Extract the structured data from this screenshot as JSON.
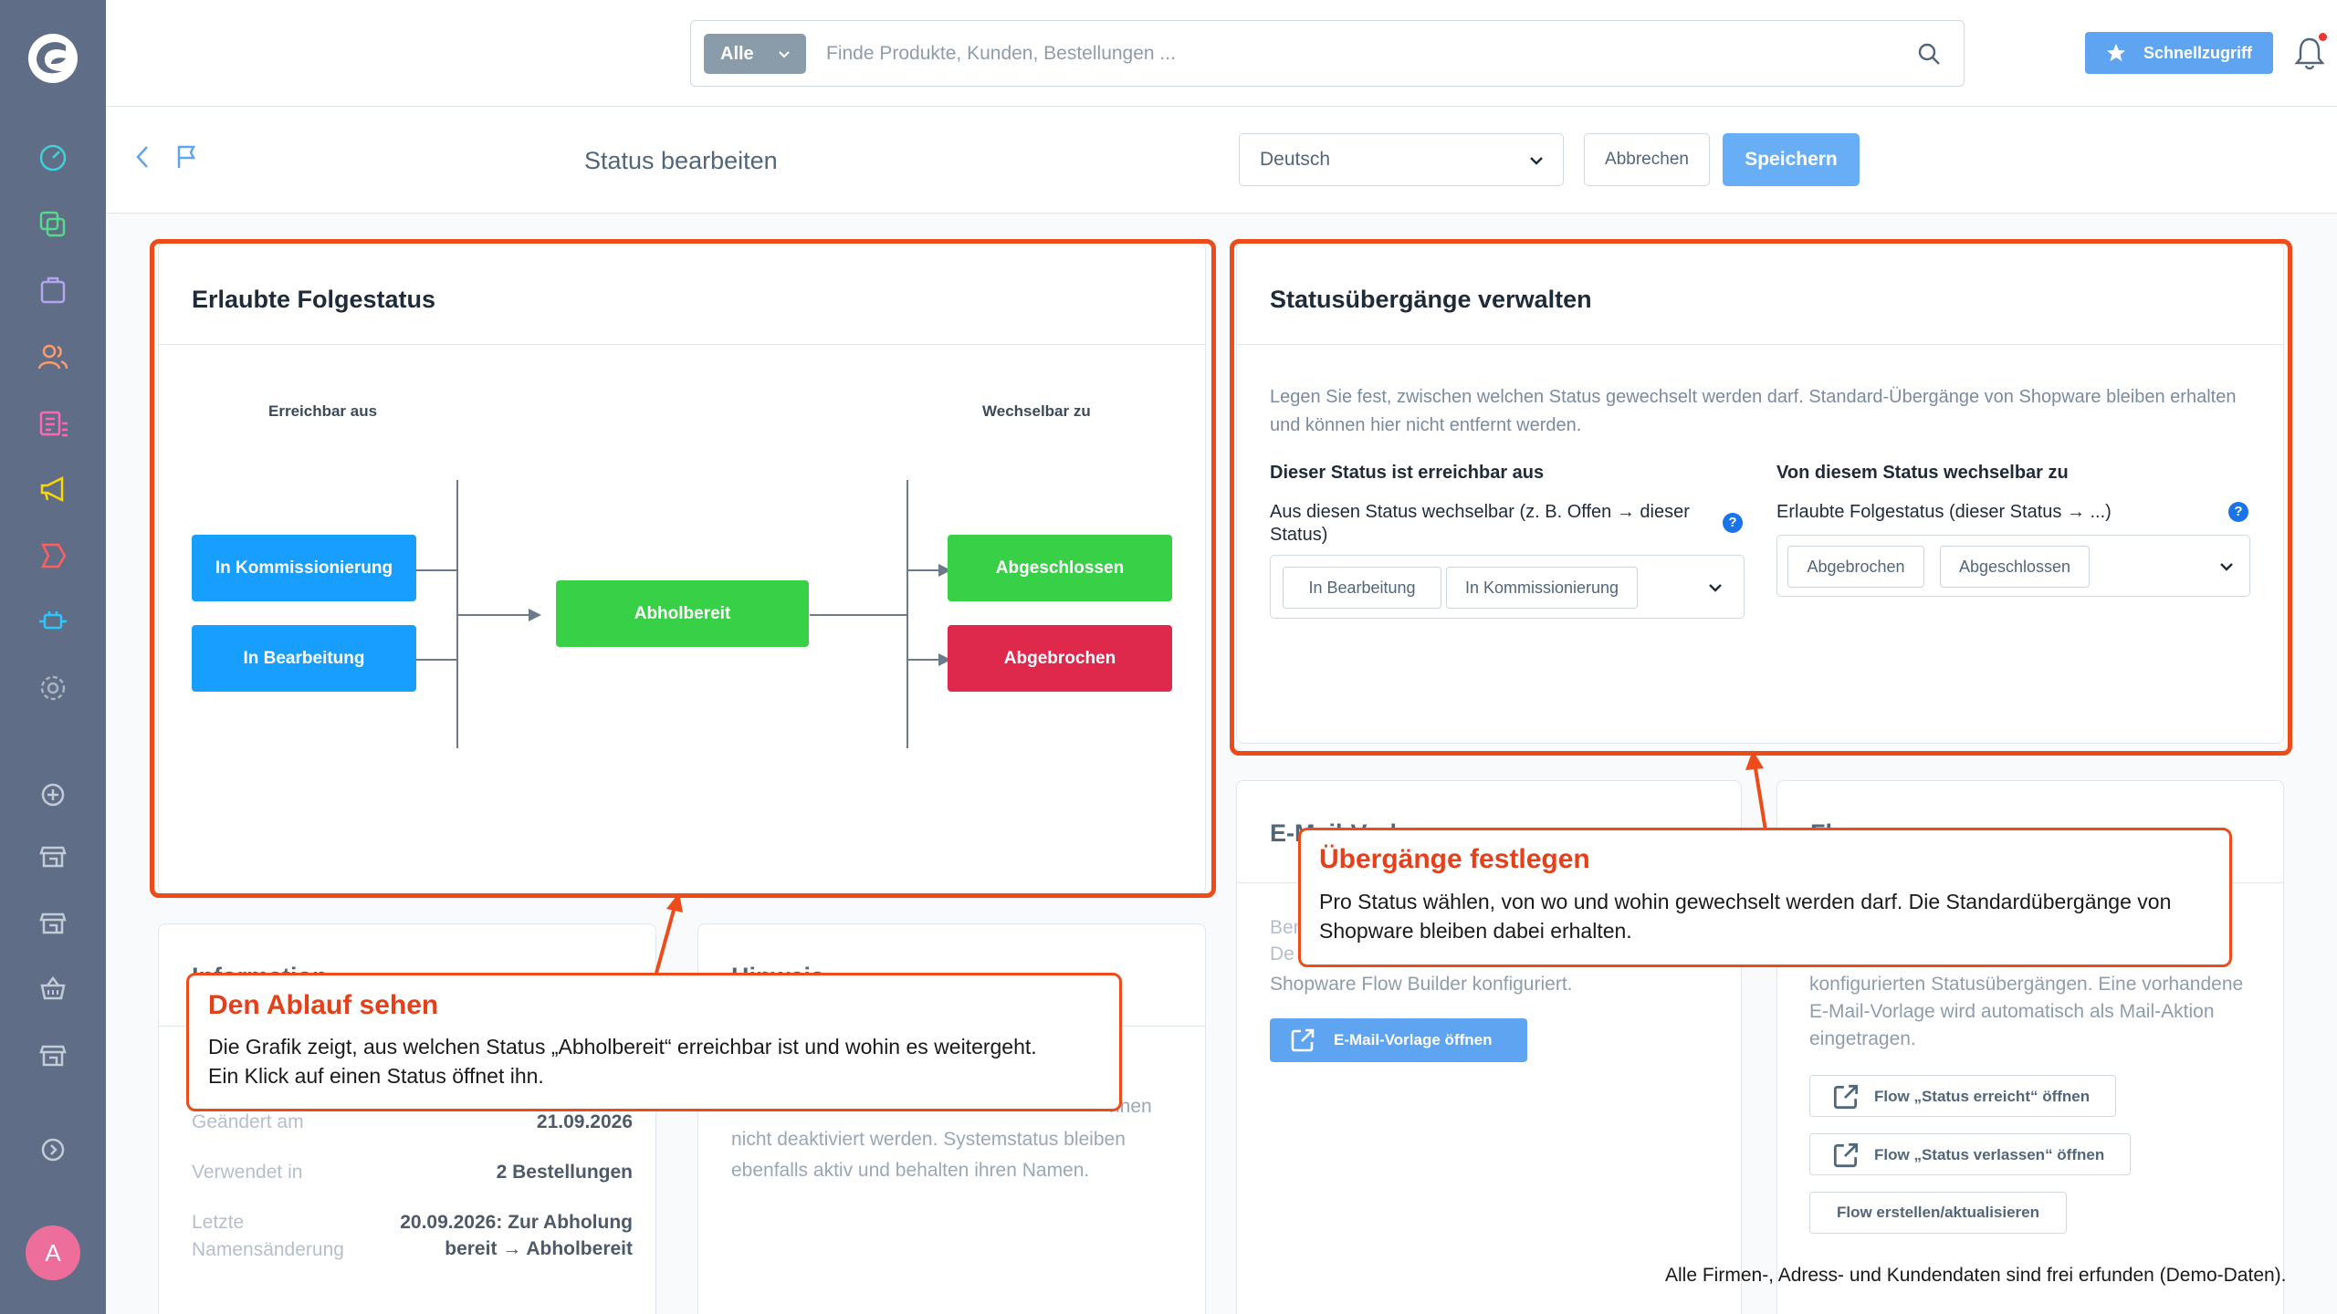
{
  "header": {
    "search_type": "Alle",
    "search_placeholder": "Finde Produkte, Kunden, Bestellungen ...",
    "quick_access": "Schnellzugriff"
  },
  "sidebar": {
    "icons": [
      "dashboard-icon",
      "catalogue-icon",
      "orders-icon",
      "customers-icon",
      "content-icon",
      "marketing-icon",
      "extensions-icon",
      "plugins-icon",
      "settings-icon",
      "add-sales-channel-icon",
      "storefront-icon",
      "headless-icon",
      "pos-icon",
      "store-icon",
      "collapse-icon"
    ],
    "avatar_letter": "A"
  },
  "page": {
    "title": "Status bearbeiten",
    "language": "Deutsch",
    "cancel": "Abbrechen",
    "save": "Speichern"
  },
  "flow_card": {
    "title": "Erlaubte Folgestatus",
    "col_from": "Erreichbar aus",
    "col_to": "Wechselbar zu",
    "from_nodes": [
      "In Kommissionierung",
      "In Bearbeitung"
    ],
    "center_node": "Abholbereit",
    "to_nodes": [
      "Abgeschlossen",
      "Abgebrochen"
    ],
    "colors": {
      "blue": "#189eff",
      "green": "#37d046",
      "red": "#de294c"
    }
  },
  "transitions_card": {
    "title": "Statusübergänge verwalten",
    "description": "Legen Sie fest, zwischen welchen Status gewechselt werden darf. Standard-Übergänge von Shopware bleiben erhalten und können hier nicht entfernt werden.",
    "reachable_label": "Dieser Status ist erreichbar aus",
    "reachable_sublabel": "Aus diesen Status wechselbar (z. B. Offen → dieser Status)",
    "reachable_values": [
      "In Bearbeitung",
      "In Kommissionierung"
    ],
    "switchable_label": "Von diesem Status wechselbar zu",
    "switchable_sublabel": "Erlaubte Folgestatus (dieser Status → ...)",
    "switchable_values": [
      "Abgebrochen",
      "Abgeschlossen"
    ],
    "help": "?"
  },
  "email_card": {
    "title_partial": "E-Mail-Vorlage",
    "text_fragments": [
      "Ber",
      "De"
    ],
    "text_line": "Shopware Flow Builder konfiguriert.",
    "button": "E-Mail-Vorlage öffnen"
  },
  "flow_actions_card": {
    "title_partial": "Flow",
    "text": "konfigurierten Statusübergängen. Eine vorhandene E-Mail-Vorlage wird automatisch als Mail-Aktion eingetragen.",
    "btn_reached": "Flow „Status erreicht“ öffnen",
    "btn_left": "Flow „Status verlassen“ öffnen",
    "btn_create": "Flow erstellen/aktualisieren"
  },
  "info_card": {
    "title_partial": "Information",
    "rows": [
      {
        "label": "Geändert am",
        "value": "21.09.2026"
      },
      {
        "label": "Verwendet in",
        "value": "2 Bestellungen"
      },
      {
        "label": "Letzte Namensänderung",
        "value": "20.09.2026: Zur Abholung bereit → Abholbereit"
      }
    ]
  },
  "hint_card": {
    "title_partial": "Hinweis",
    "text_fragment": "nnen",
    "text": "nicht deaktiviert werden. Systemstatus bleiben ebenfalls aktiv und behalten ihren Namen."
  },
  "callouts": {
    "flow_title": "Den Ablauf sehen",
    "flow_text": "Die Grafik zeigt, aus welchen Status „Abholbereit“ erreichbar ist und wohin es weitergeht. Ein Klick auf einen Status öffnet ihn.",
    "transitions_title": "Übergänge festlegen",
    "transitions_text": "Pro Status wählen, von wo und wohin gewechselt werden darf. Die Standardübergänge von Shopware bleiben dabei erhalten."
  },
  "disclaimer": "Alle Firmen-, Adress- und Kundendaten sind frei erfunden (Demo-Daten).",
  "colors": {
    "accent": "#5ea4f0",
    "highlight": "#ee4b1b",
    "sidebar": "#5f6d86"
  }
}
